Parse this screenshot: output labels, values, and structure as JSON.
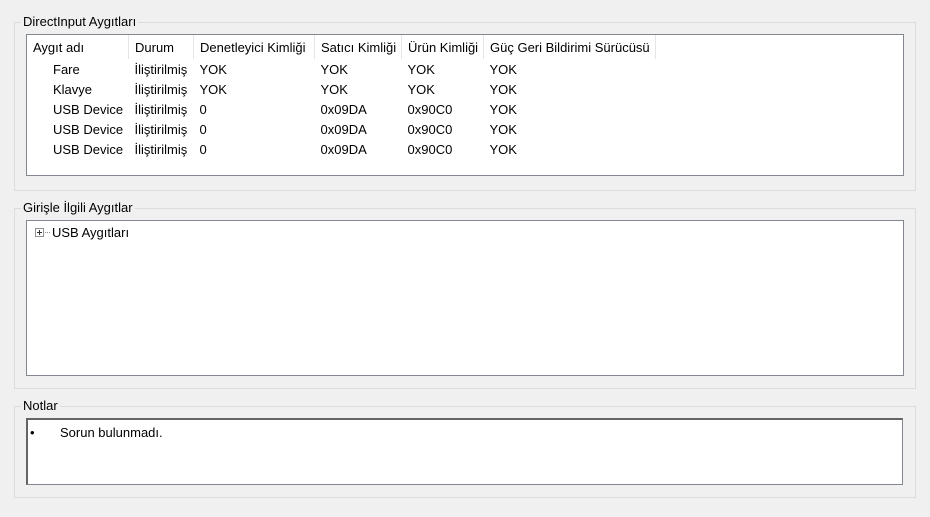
{
  "directinput": {
    "title": "DirectInput Aygıtları",
    "columns": [
      "Aygıt adı",
      "Durum",
      "Denetleyici Kimliği",
      "Satıcı Kimliği",
      "Ürün Kimliği",
      "Güç Geri Bildirimi Sürücüsü"
    ],
    "rows": [
      [
        "Fare",
        "İliştirilmiş",
        "YOK",
        "YOK",
        "YOK",
        "YOK"
      ],
      [
        "Klavye",
        "İliştirilmiş",
        "YOK",
        "YOK",
        "YOK",
        "YOK"
      ],
      [
        "USB Device",
        "İliştirilmiş",
        "0",
        "0x09DA",
        "0x90C0",
        "YOK"
      ],
      [
        "USB Device",
        "İliştirilmiş",
        "0",
        "0x09DA",
        "0x90C0",
        "YOK"
      ],
      [
        "USB Device",
        "İliştirilmiş",
        "0",
        "0x09DA",
        "0x90C0",
        "YOK"
      ]
    ]
  },
  "input_devices": {
    "title": "Girişle İlgili Aygıtlar",
    "tree": [
      {
        "label": "USB Aygıtları",
        "icon": "expand-plus-icon"
      }
    ]
  },
  "notes": {
    "title": "Notlar",
    "bullet": "•",
    "items": [
      "Sorun bulunmadı."
    ]
  }
}
